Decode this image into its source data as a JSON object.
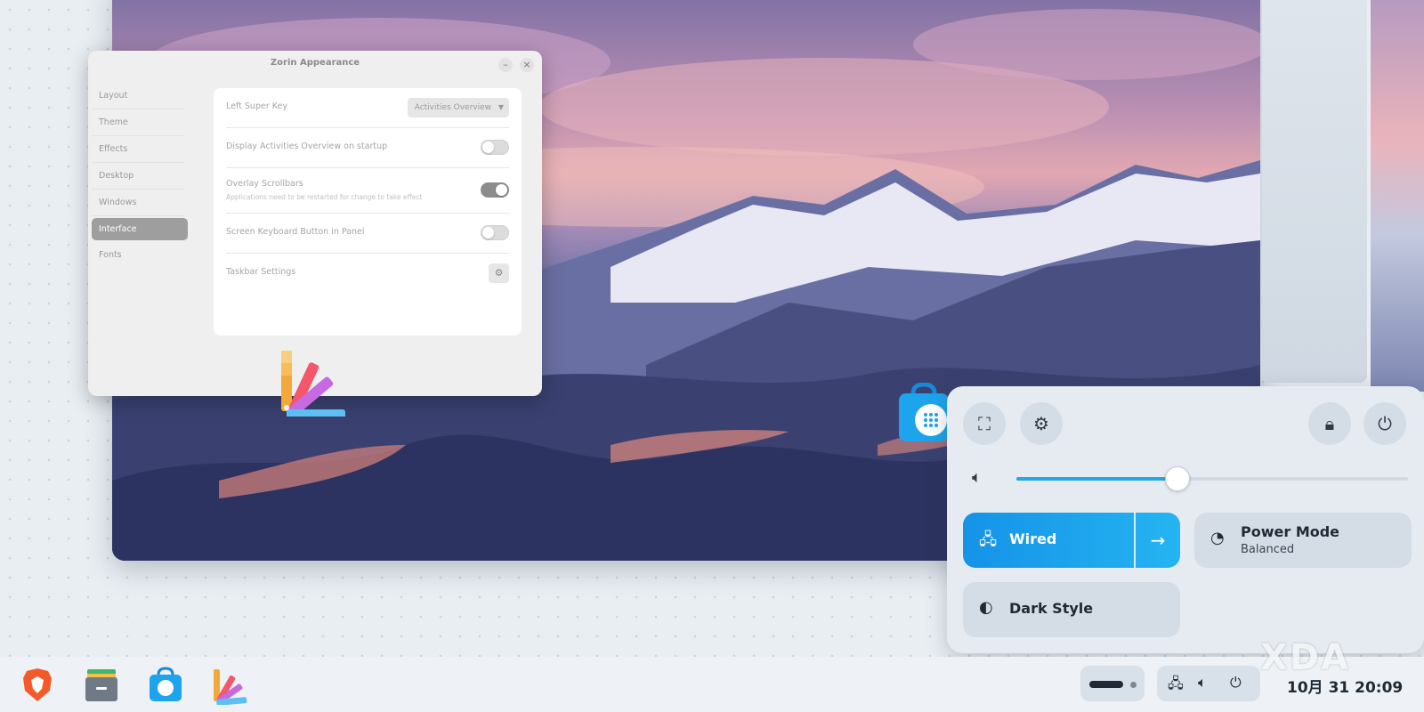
{
  "window": {
    "title": "Zorin Appearance",
    "minimize_label": "–",
    "close_label": "×"
  },
  "sidebar": {
    "items": [
      {
        "label": "Layout"
      },
      {
        "label": "Theme"
      },
      {
        "label": "Effects"
      },
      {
        "label": "Desktop"
      },
      {
        "label": "Windows"
      },
      {
        "label": "Interface"
      },
      {
        "label": "Fonts"
      }
    ],
    "active": "Interface"
  },
  "settings": {
    "left_super_key": {
      "label": "Left Super Key",
      "value": "Activities Overview"
    },
    "activities_startup": {
      "label": "Display Activities Overview on startup",
      "on": false
    },
    "overlay_scrollbars": {
      "label": "Overlay Scrollbars",
      "sub": "Applications need to be restarted for change to take effect",
      "on": true
    },
    "screen_keyboard": {
      "label": "Screen Keyboard Button in Panel",
      "on": false
    },
    "taskbar_settings": {
      "label": "Taskbar Settings"
    }
  },
  "quick_settings": {
    "volume_percent": 41,
    "wired": {
      "label": "Wired"
    },
    "power_mode": {
      "label": "Power Mode",
      "sub": "Balanced"
    },
    "dark_style": {
      "label": "Dark Style"
    },
    "accent_color": "#1ea4ec"
  },
  "taskbar": {
    "clock": "10月 31  20:09",
    "icons": [
      "brave-icon",
      "files-icon",
      "software-store-icon",
      "appearance-icon"
    ]
  },
  "watermark": "XDA"
}
